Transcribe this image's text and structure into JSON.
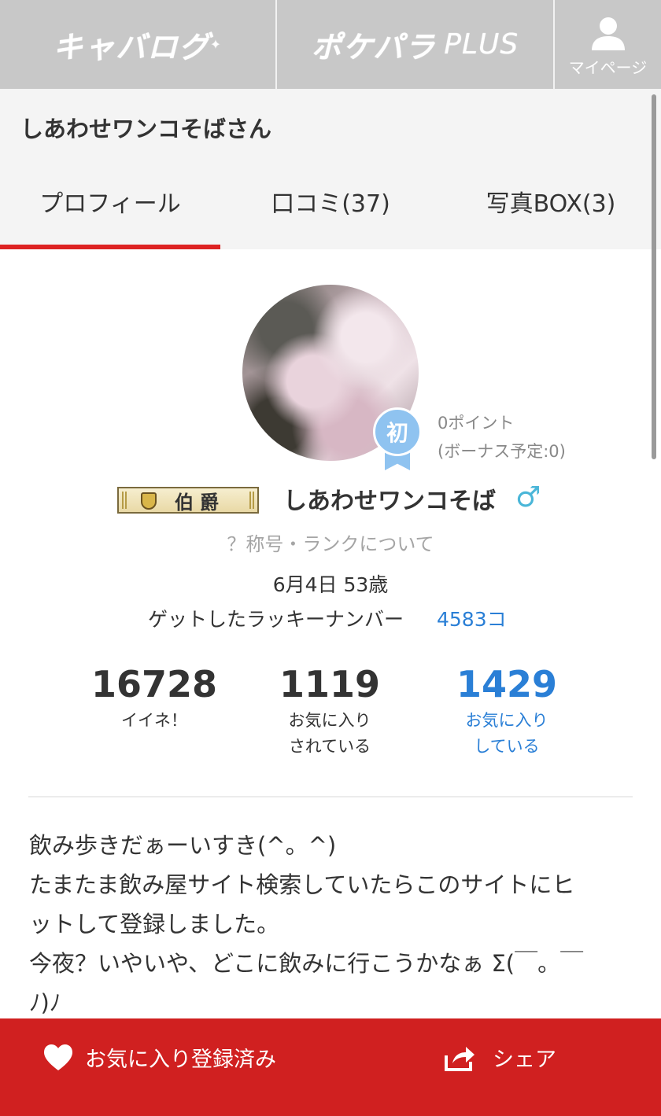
{
  "nav": {
    "logo1": "キャバログ",
    "logo2": "ポケパラ",
    "logo2_suffix": "PLUS",
    "mypage_label": "マイページ"
  },
  "header": {
    "title": "しあわせワンコそばさん"
  },
  "tabs": [
    {
      "label": "プロフィール",
      "active": true
    },
    {
      "label": "口コミ(37)",
      "active": false
    },
    {
      "label": "写真BOX(3)",
      "active": false
    }
  ],
  "profile": {
    "badge_text": "初",
    "points": "0ポイント",
    "bonus": "(ボーナス予定:0)",
    "rank_title": "伯爵",
    "username": "しあわせワンコそば",
    "gender_symbol": "♂",
    "rank_link": "？称号・ランクについて",
    "birthday": "6月4日 53歳",
    "lucky_label": "ゲットしたラッキーナンバー",
    "lucky_value": "4583コ"
  },
  "stats": [
    {
      "value": "16728",
      "label_line1": "イイネ！",
      "label_line2": ""
    },
    {
      "value": "1119",
      "label_line1": "お気に入り",
      "label_line2": "されている"
    },
    {
      "value": "1429",
      "label_line1": "お気に入り",
      "label_line2": "している"
    }
  ],
  "bio": {
    "line1": "飲み歩きだぁーいすき(^。^)",
    "line2": "たまたま飲み屋サイト検索していたらこのサイトにヒ",
    "line3": "ットして登録しました。",
    "line4": "今夜？いやいや、どこに飲みに行こうかなぁ Σ(￣。￣",
    "line5": "ﾉ)ﾉ"
  },
  "bottom": {
    "favorite_label": "お気に入り登録済み",
    "share_label": "シェア"
  },
  "colors": {
    "accent_red": "#d02020",
    "link_blue": "#2a7fd6",
    "nav_gray": "#c8c8c8",
    "badge_blue": "#8fc3f0"
  }
}
